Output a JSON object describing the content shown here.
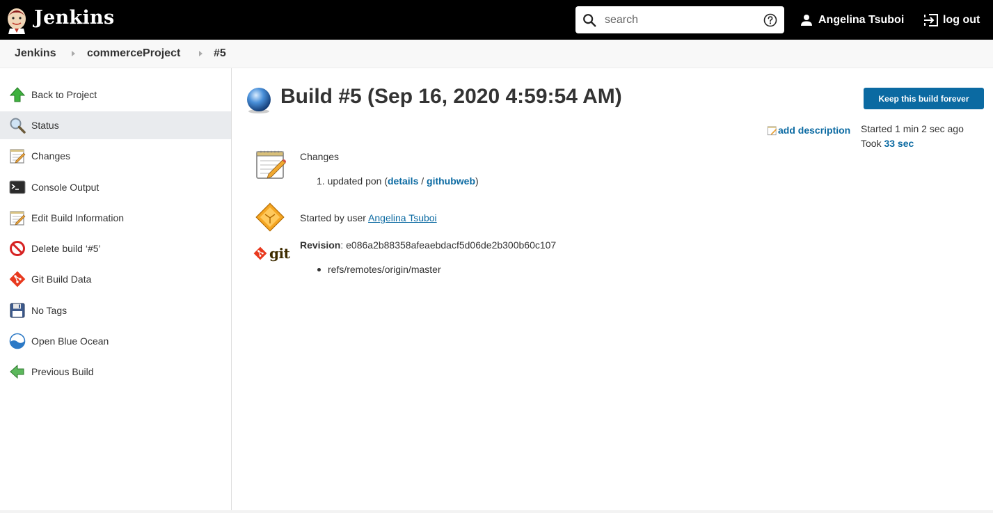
{
  "header": {
    "brand": "Jenkins",
    "search_placeholder": "search",
    "user_name": "Angelina Tsuboi",
    "logout_label": "log out"
  },
  "breadcrumb": {
    "items": [
      "Jenkins",
      "commerceProject",
      "#5"
    ]
  },
  "sidebar": {
    "items": [
      {
        "label": "Back to Project",
        "icon": "up-arrow-icon"
      },
      {
        "label": "Status",
        "icon": "magnifier-icon",
        "active": true
      },
      {
        "label": "Changes",
        "icon": "notepad-icon"
      },
      {
        "label": "Console Output",
        "icon": "terminal-icon"
      },
      {
        "label": "Edit Build Information",
        "icon": "notepad-icon"
      },
      {
        "label": "Delete build ‘#5’",
        "icon": "no-entry-icon"
      },
      {
        "label": "Git Build Data",
        "icon": "git-icon"
      },
      {
        "label": "No Tags",
        "icon": "floppy-icon"
      },
      {
        "label": "Open Blue Ocean",
        "icon": "blue-ocean-icon"
      },
      {
        "label": "Previous Build",
        "icon": "left-arrow-icon"
      }
    ]
  },
  "main": {
    "title": "Build #5 (Sep 16, 2020 4:59:54 AM)",
    "keep_button": "Keep this build forever",
    "add_description": "add description",
    "started_text": "Started 1 min 2 sec ago",
    "took_prefix": "Took",
    "took_value": "33 sec",
    "changes_title": "Changes",
    "change_number": "1.",
    "change_text": "updated pon",
    "change_details": "details",
    "change_githubweb": "githubweb",
    "started_by_prefix": "Started by user",
    "started_by_user": "Angelina Tsuboi",
    "revision_label": "Revision",
    "revision_hash": "e086a2b88358afeaebdacf5d06de2b300b60c107",
    "ref": "refs/remotes/origin/master",
    "git_logo_text": "git"
  },
  "colors": {
    "header_bg": "#000000",
    "link": "#0b6aa2",
    "button_bg": "#0b6aa2",
    "sidebar_active": "#e9ebee"
  }
}
